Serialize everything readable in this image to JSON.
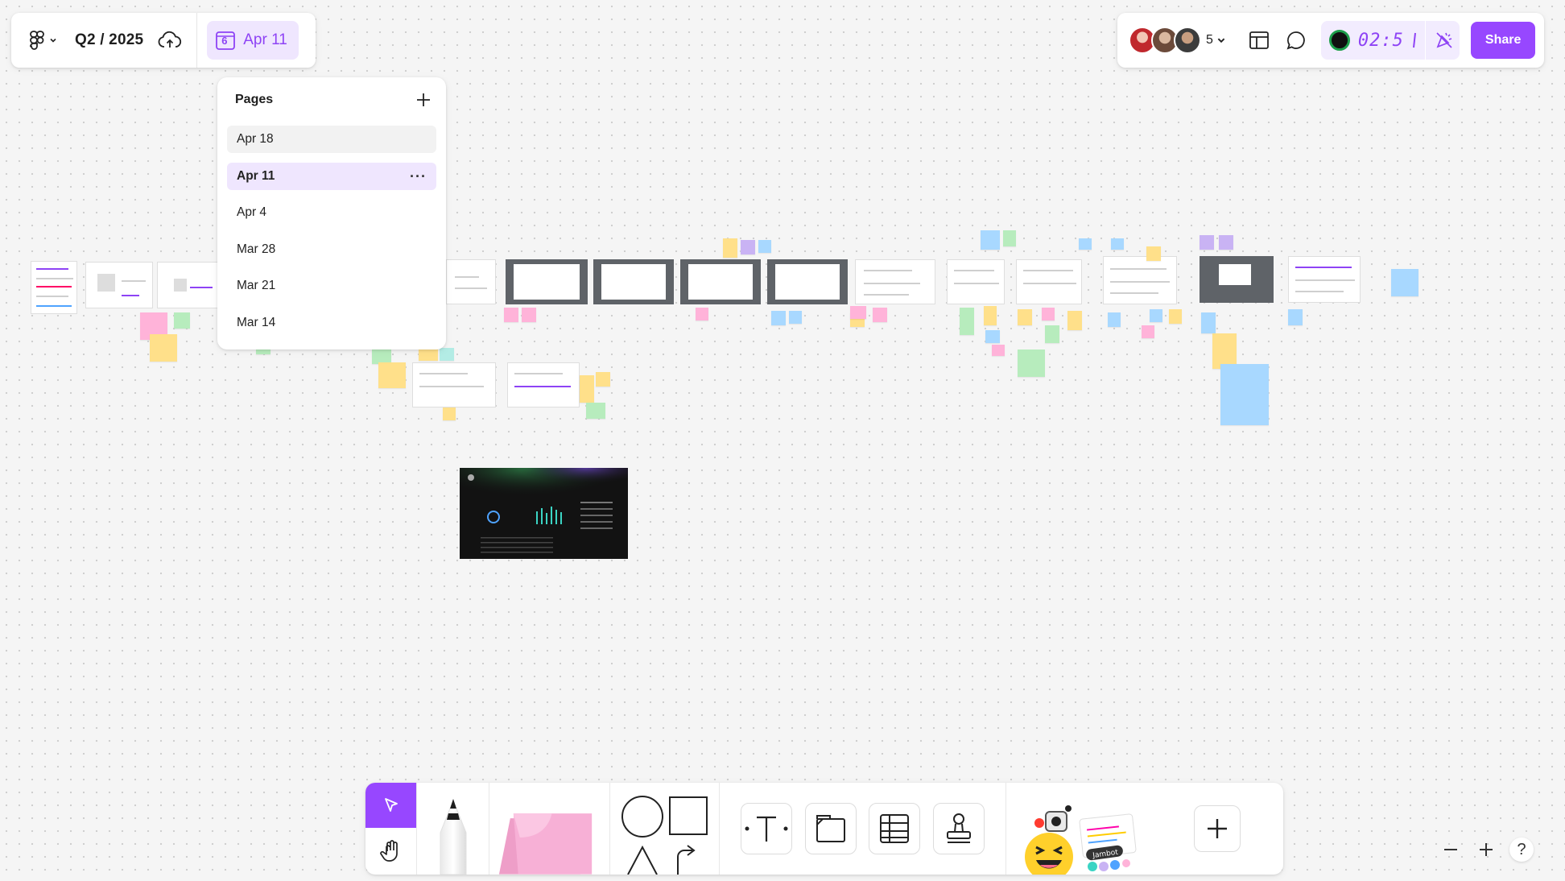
{
  "file_bar": {
    "main_menu_icon": "figjam-logo-icon",
    "file_title": "Q2 / 2025",
    "cloud_icon": "cloud-upload-icon",
    "current_page_icon": "calendar-icon",
    "current_page_number": "6",
    "current_page_label": "Apr 11"
  },
  "pages_panel": {
    "title": "Pages",
    "add_icon": "plus-icon",
    "items": [
      {
        "label": "Apr 18"
      },
      {
        "label": "Apr 11"
      },
      {
        "label": "Apr 4"
      },
      {
        "label": "Mar 28"
      },
      {
        "label": "Mar 21"
      },
      {
        "label": "Mar 14"
      }
    ],
    "more_glyph": "···"
  },
  "top_right": {
    "collaborator_count": "5",
    "timer_value": "02:5",
    "share_label": "Share",
    "colors": {
      "accent": "#9747ff",
      "accent_light": "#efe6fe"
    }
  },
  "toolbar": {
    "tools": [
      "select-tool",
      "hand-tool",
      "marker-tool",
      "sticky-note-tool",
      "shape-tool",
      "text-tool",
      "section-tool",
      "table-tool",
      "stamp-tool",
      "widgets-tool",
      "more-tools"
    ]
  },
  "widgets": {
    "jambot_label": "Jambot"
  },
  "zoom": {
    "help_label": "?"
  }
}
